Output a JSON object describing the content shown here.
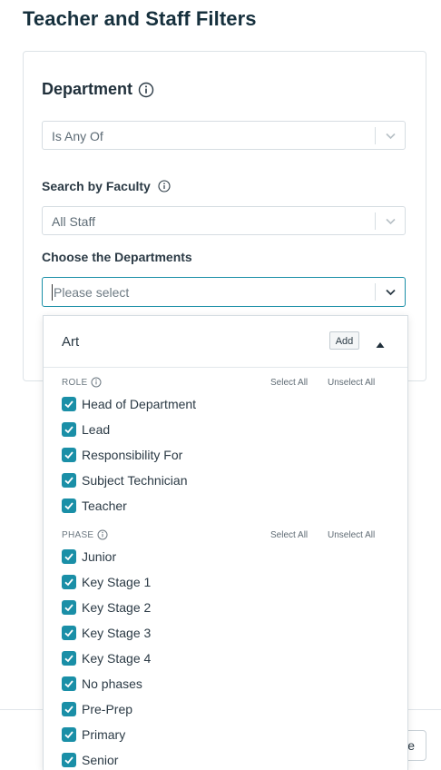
{
  "page": {
    "title": "Teacher and Staff Filters"
  },
  "department": {
    "title": "Department",
    "operator": {
      "value": "Is Any Of"
    }
  },
  "faculty": {
    "label": "Search by Faculty",
    "value": "All Staff"
  },
  "departments_select": {
    "label": "Choose the Departments",
    "placeholder": "Please select"
  },
  "dropdown": {
    "group": "Art",
    "add_label": "Add",
    "role": {
      "heading": "ROLE",
      "select_all": "Select All",
      "unselect_all": "Unselect All",
      "options": [
        {
          "label": "Head of Department",
          "checked": true
        },
        {
          "label": "Lead",
          "checked": true
        },
        {
          "label": "Responsibility For",
          "checked": true
        },
        {
          "label": "Subject Technician",
          "checked": true
        },
        {
          "label": "Teacher",
          "checked": true
        }
      ]
    },
    "phase": {
      "heading": "PHASE",
      "select_all": "Select All",
      "unselect_all": "Unselect All",
      "options": [
        {
          "label": "Junior",
          "checked": true
        },
        {
          "label": "Key Stage 1",
          "checked": true
        },
        {
          "label": "Key Stage 2",
          "checked": true
        },
        {
          "label": "Key Stage 3",
          "checked": true
        },
        {
          "label": "Key Stage 4",
          "checked": true
        },
        {
          "label": "No phases",
          "checked": true
        },
        {
          "label": "Pre-Prep",
          "checked": true
        },
        {
          "label": "Primary",
          "checked": true
        },
        {
          "label": "Senior",
          "checked": true
        }
      ]
    }
  },
  "footer": {
    "partial_button_text": "e"
  },
  "colors": {
    "accent": "#1a8fa7",
    "title": "#16303d"
  }
}
